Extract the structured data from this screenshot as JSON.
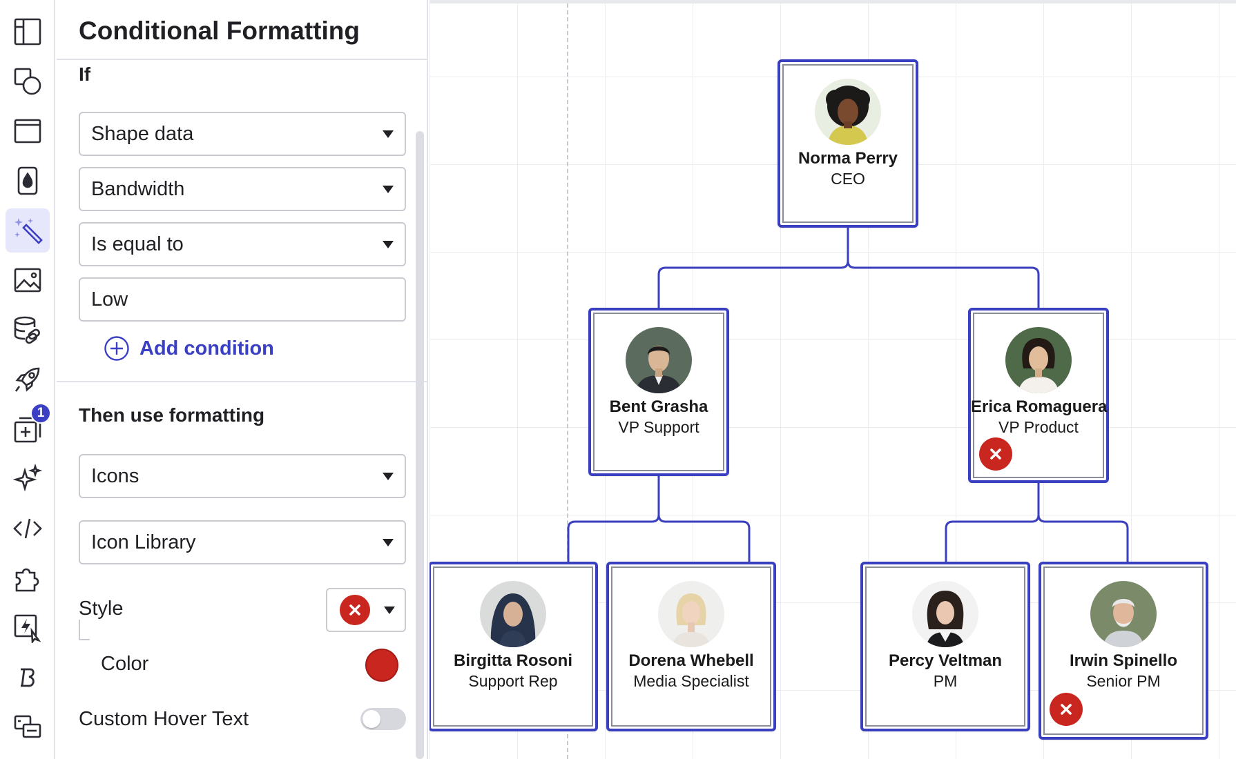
{
  "panel": {
    "title": "Conditional Formatting",
    "if_label": "If",
    "condition": {
      "source": "Shape data",
      "field": "Bandwidth",
      "operator": "Is equal to",
      "value": "Low"
    },
    "add_condition_label": "Add condition",
    "then_label": "Then use formatting",
    "format_type": "Icons",
    "icon_source": "Icon Library",
    "style_label": "Style",
    "style_icon": "x-circle-icon",
    "color_label": "Color",
    "color_value": "#c9261f",
    "hover_text_label": "Custom Hover Text",
    "hover_text_enabled": false
  },
  "rail": {
    "badge_count": "1",
    "items": [
      "layout-icon",
      "shapes-icon",
      "page-icon",
      "fill-icon",
      "magic-wand-icon",
      "image-icon",
      "data-link-icon",
      "rocket-icon",
      "add-frame-icon",
      "sparkle-icon",
      "code-icon",
      "puzzle-icon",
      "action-icon",
      "brand-icon",
      "integration-icon"
    ],
    "active": "magic-wand-icon"
  },
  "accent_color": "#3a3fbf",
  "org_chart": {
    "nodes": [
      {
        "id": "norma",
        "name": "Norma Perry",
        "title": "CEO",
        "flag": false
      },
      {
        "id": "bent",
        "name": "Bent Grasha",
        "title": "VP Support",
        "flag": false
      },
      {
        "id": "erica",
        "name": "Erica Romaguera",
        "title": "VP Product",
        "flag": true
      },
      {
        "id": "birgitta",
        "name": "Birgitta Rosoni",
        "title": "Support Rep",
        "flag": false
      },
      {
        "id": "dorena",
        "name": "Dorena Whebell",
        "title": "Media Specialist",
        "flag": false
      },
      {
        "id": "percy",
        "name": "Percy Veltman",
        "title": "PM",
        "flag": false
      },
      {
        "id": "irwin",
        "name": "Irwin Spinello",
        "title": "Senior PM",
        "flag": true
      }
    ]
  }
}
